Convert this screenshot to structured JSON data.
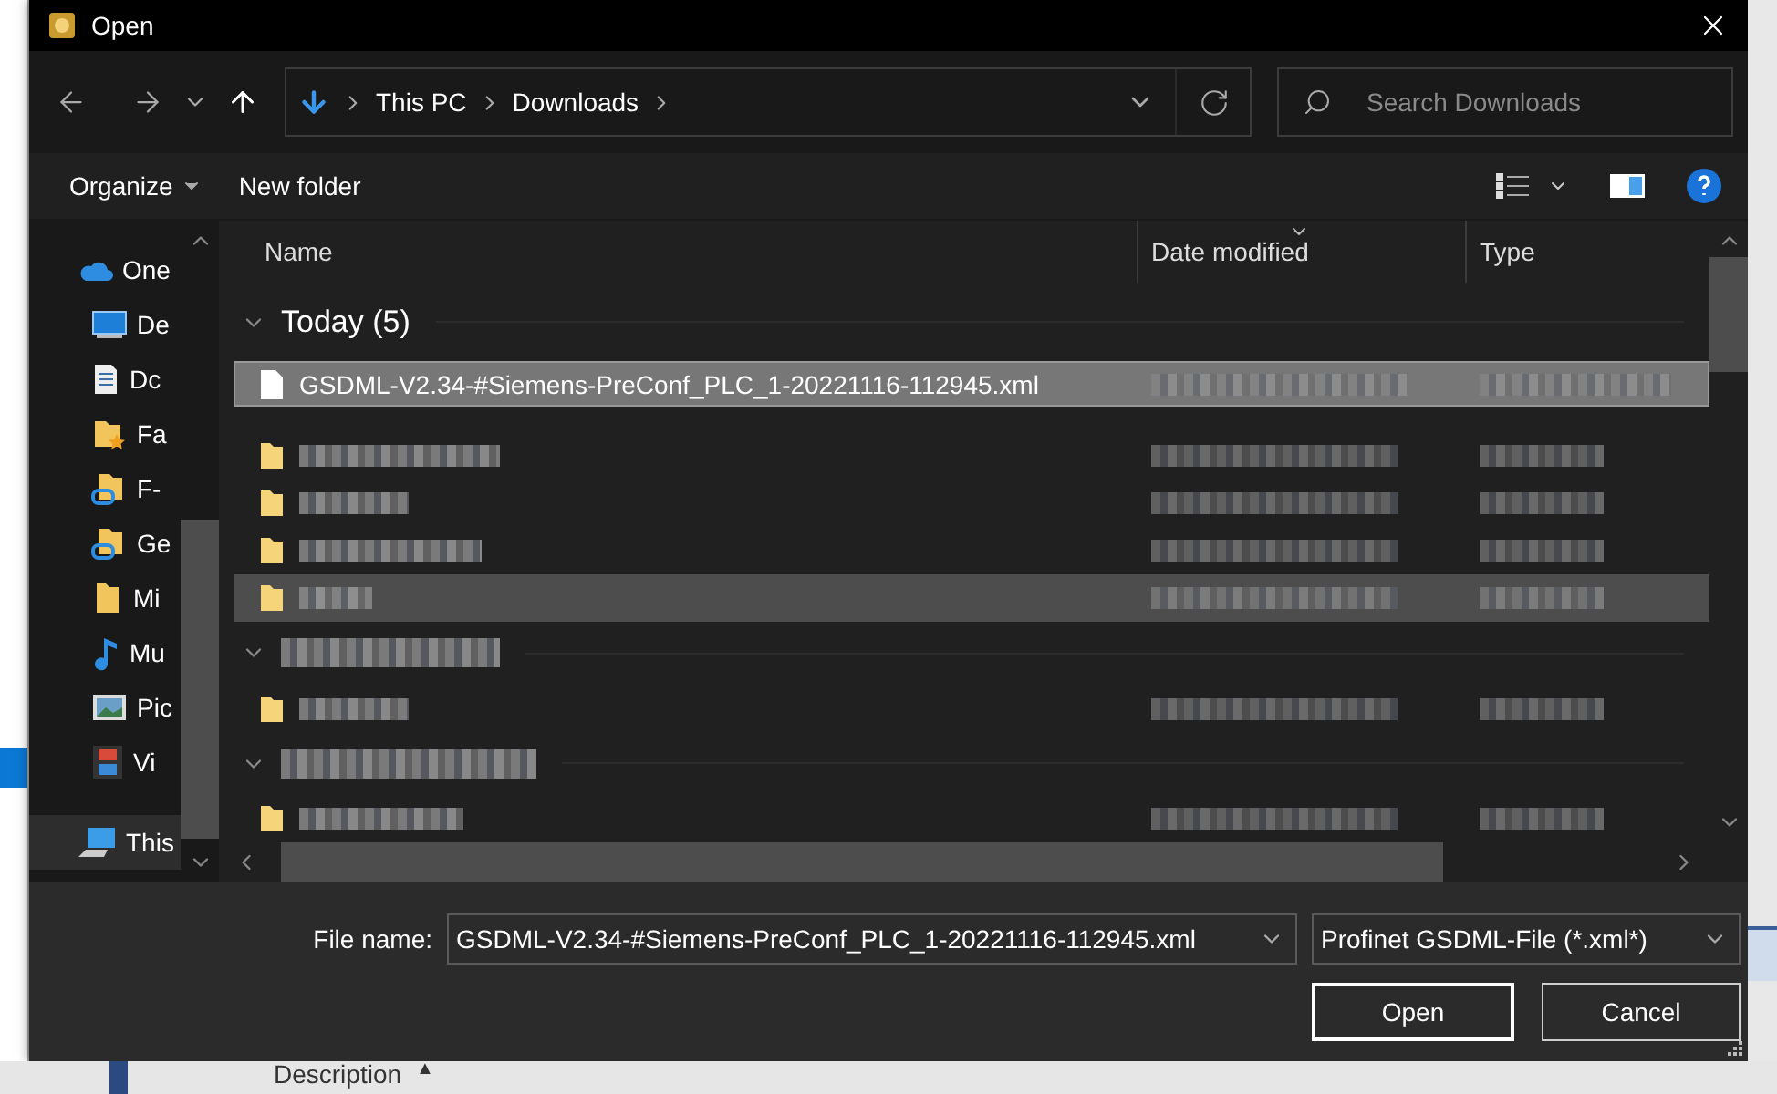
{
  "window": {
    "title": "Open"
  },
  "navigation": {
    "breadcrumbs": [
      "This PC",
      "Downloads"
    ],
    "search": {
      "placeholder": "Search Downloads"
    }
  },
  "command_bar": {
    "buttons": [
      {
        "label": "Organize",
        "kind": "menu"
      },
      {
        "label": "New folder",
        "kind": "plain"
      }
    ]
  },
  "sidebar": {
    "items": [
      {
        "label": "One",
        "kind": "location",
        "selected": false
      },
      {
        "label": "De",
        "kind": "pinned",
        "selected": false
      },
      {
        "label": "Dc",
        "kind": "pinned",
        "selected": false
      },
      {
        "label": "Fa",
        "kind": "pinned",
        "selected": false
      },
      {
        "label": "F-",
        "kind": "pinned",
        "selected": false
      },
      {
        "label": "Ge",
        "kind": "pinned",
        "selected": false
      },
      {
        "label": "Mi",
        "kind": "pinned",
        "selected": false
      },
      {
        "label": "Mu",
        "kind": "pinned",
        "selected": false
      },
      {
        "label": "Pic",
        "kind": "pinned",
        "selected": false
      },
      {
        "label": "Vi",
        "kind": "pinned",
        "selected": false
      },
      {
        "label": "This",
        "kind": "location",
        "selected": true
      }
    ]
  },
  "file_list": {
    "columns": [
      {
        "label": "Name",
        "sorted": false
      },
      {
        "label": "Date modified",
        "sorted": true
      },
      {
        "label": "Type",
        "sorted": false
      }
    ],
    "groups": [
      {
        "kind": "text",
        "label": "Today (5)",
        "expanded": true,
        "rows": [
          {
            "kind": "file",
            "name": "GSDML-V2.34-#Siemens-PreConf_PLC_1-20221116-112945.xml",
            "selected": true,
            "hovered": false
          },
          {
            "kind": "folder",
            "selected": false,
            "hovered": false
          },
          {
            "kind": "folder",
            "selected": false,
            "hovered": false
          },
          {
            "kind": "folder",
            "selected": false,
            "hovered": false
          },
          {
            "kind": "folder",
            "selected": false,
            "hovered": true
          }
        ]
      },
      {
        "kind": "redacted",
        "expanded": true,
        "rows": [
          {
            "kind": "folder",
            "selected": false,
            "hovered": false
          }
        ]
      },
      {
        "kind": "redacted",
        "expanded": true,
        "rows": [
          {
            "kind": "folder",
            "selected": false,
            "hovered": false
          }
        ]
      }
    ]
  },
  "footer": {
    "file_name": {
      "label": "File name:",
      "value": "GSDML-V2.34-#Siemens-PreConf_PLC_1-20221116-112945.xml"
    },
    "file_type": "Profinet GSDML-File (*.xml*)",
    "buttons": [
      {
        "label": "Open",
        "default": true
      },
      {
        "label": "Cancel",
        "default": false
      }
    ]
  },
  "background": {
    "column_header": "Description",
    "sort_caret": "▲"
  }
}
